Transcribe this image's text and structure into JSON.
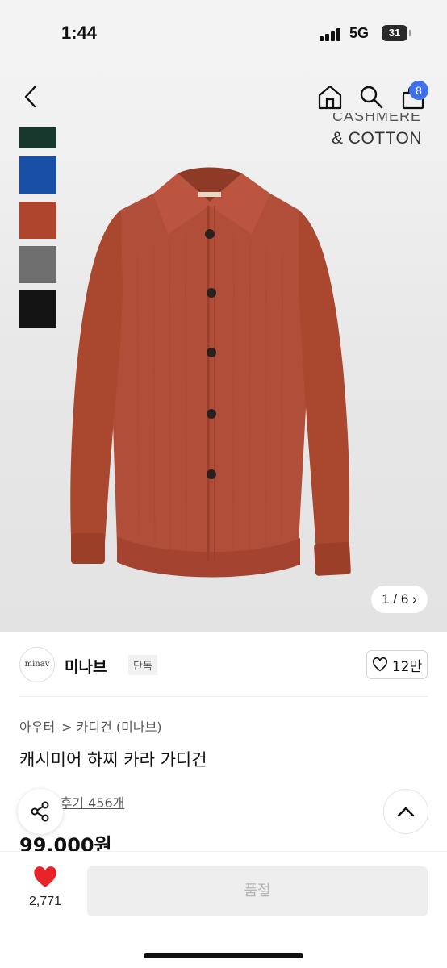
{
  "status": {
    "time": "1:44",
    "network": "5G",
    "battery": "31"
  },
  "header": {
    "cart_count": "8"
  },
  "hero": {
    "brand_tag_line1": "CASHMERE",
    "brand_tag_line2": "& COTTON",
    "counter": "1 / 6",
    "swatch_colors": [
      "#17382c",
      "#1a4fa6",
      "#b0452d",
      "#6f6f6f",
      "#141414"
    ],
    "garment_color": "#b14e3a"
  },
  "store": {
    "logo_text": "minav",
    "name": "미나브",
    "tag": "단독",
    "likes": "12만"
  },
  "product": {
    "breadcrumb": [
      "아우터",
      "> 카디건 (미나브)"
    ],
    "title": "캐시미어 하찌 카라 가디건",
    "review_link": "후기 456개",
    "price": "99,000원"
  },
  "bottom": {
    "wish_count": "2,771",
    "soldout_label": "품절"
  },
  "colors": {
    "accent": "#3f70e8",
    "heart": "#e8232a"
  }
}
